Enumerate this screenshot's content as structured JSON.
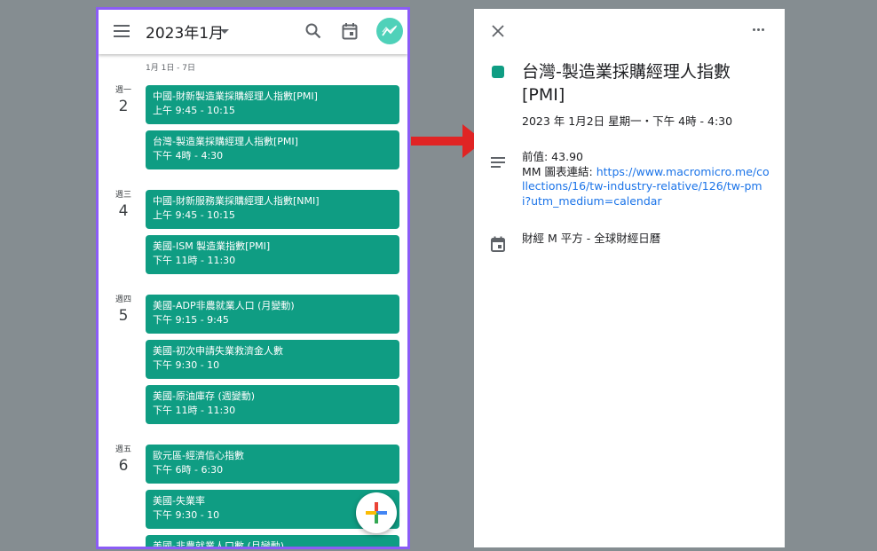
{
  "left_app": {
    "month_title": "2023年1月",
    "week_range": "1月 1日 - 7日",
    "days": [
      {
        "day_name": "週一",
        "day_num": "2",
        "events": [
          {
            "title": "中國-財新製造業採購經理人指數[PMI]",
            "time": "上午 9:45 - 10:15"
          },
          {
            "title": "台灣-製造業採購經理人指數[PMI]",
            "time": "下午 4時 - 4:30"
          }
        ]
      },
      {
        "day_name": "週三",
        "day_num": "4",
        "events": [
          {
            "title": "中國-財新服務業採購經理人指數[NMI]",
            "time": "上午 9:45 - 10:15"
          },
          {
            "title": "美國-ISM 製造業指數[PMI]",
            "time": "下午 11時 - 11:30"
          }
        ]
      },
      {
        "day_name": "週四",
        "day_num": "5",
        "events": [
          {
            "title": "美國-ADP非農就業人口 (月變動)",
            "time": "下午 9:15 - 9:45"
          },
          {
            "title": "美國-初次申請失業救濟金人數",
            "time": "下午 9:30 - 10"
          },
          {
            "title": "美國-原油庫存 (週變動)",
            "time": "下午 11時 - 11:30"
          }
        ]
      },
      {
        "day_name": "週五",
        "day_num": "6",
        "events": [
          {
            "title": "歐元區-經濟信心指數",
            "time": "下午 6時 - 6:30"
          },
          {
            "title": "美國-失業率",
            "time": "下午 9:30 - 10"
          },
          {
            "title": "美國-非農就業人口數 (月變動)",
            "time": ""
          }
        ]
      }
    ]
  },
  "detail": {
    "title": "台灣-製造業採購經理人指數[PMI]",
    "datetime": "2023 年 1月2日 星期一・下午 4時 - 4:30",
    "prev_value": "前值: 43.90",
    "link_label": "MM 圖表連結: ",
    "link_url": "https://www.macromicro.me/collections/16/tw-industry-relative/126/tw-pmi?utm_medium=calendar",
    "calendar_name": "財經 M 平方 - 全球財經日曆"
  },
  "colors": {
    "event": "#0f9d83",
    "frame": "#8b5cf6",
    "arrow": "#e02424",
    "background": "#858d91"
  }
}
